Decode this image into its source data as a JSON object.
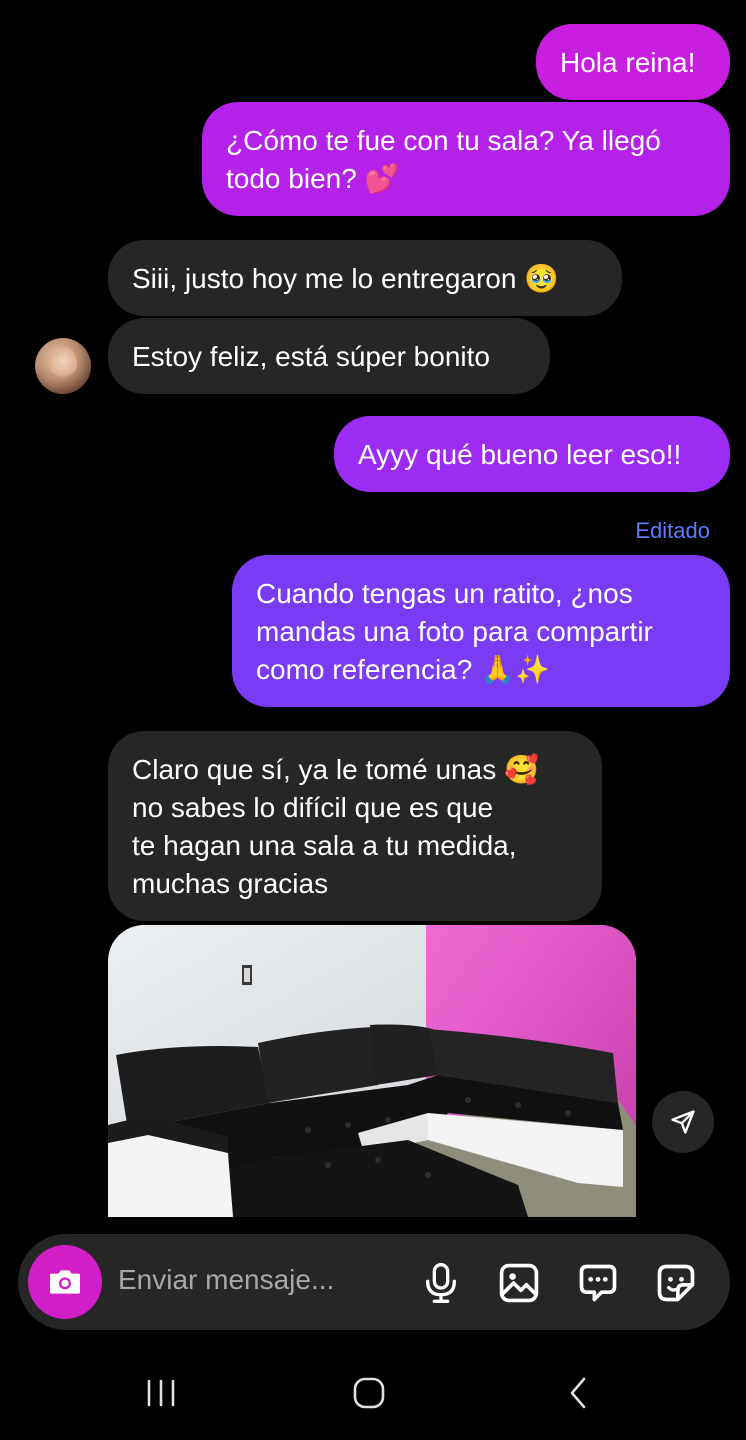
{
  "colors": {
    "outgoing_top": "#c81ee0",
    "outgoing_mid": "#9c2cf3",
    "outgoing_bottom": "#7a3bf5",
    "incoming": "#262626",
    "edited_label": "#5b7cff",
    "camera_button": "#d11fc8"
  },
  "messages": [
    {
      "side": "out",
      "text": "Hola reina!"
    },
    {
      "side": "out",
      "text": "¿Cómo te fue con tu sala? Ya llegó\ntodo bien? 💕"
    },
    {
      "side": "in",
      "text": "Siii, justo hoy me lo entregaron 🥹"
    },
    {
      "side": "in",
      "text": "Estoy feliz, está súper bonito"
    },
    {
      "side": "out",
      "text": "Ayyy qué bueno leer eso!!"
    },
    {
      "side": "out",
      "label": "Editado",
      "text": "Cuando tengas un ratito, ¿nos\nmandas una foto para compartir\ncomo referencia? 🙏✨"
    },
    {
      "side": "in",
      "text": "Claro que sí, ya le tomé unas 🥰\nno sabes lo difícil que es que\nte hagan una sala a tu medida,\nmuchas gracias"
    }
  ],
  "composer": {
    "placeholder": "Enviar mensaje...",
    "icons": [
      "camera-icon",
      "microphone-icon",
      "gallery-icon",
      "chat-bubble-icon",
      "sticker-icon"
    ]
  },
  "photo": {
    "icon": "share-send-icon"
  },
  "navigation": {
    "icons": [
      "recent-apps-icon",
      "home-icon",
      "back-icon"
    ]
  }
}
